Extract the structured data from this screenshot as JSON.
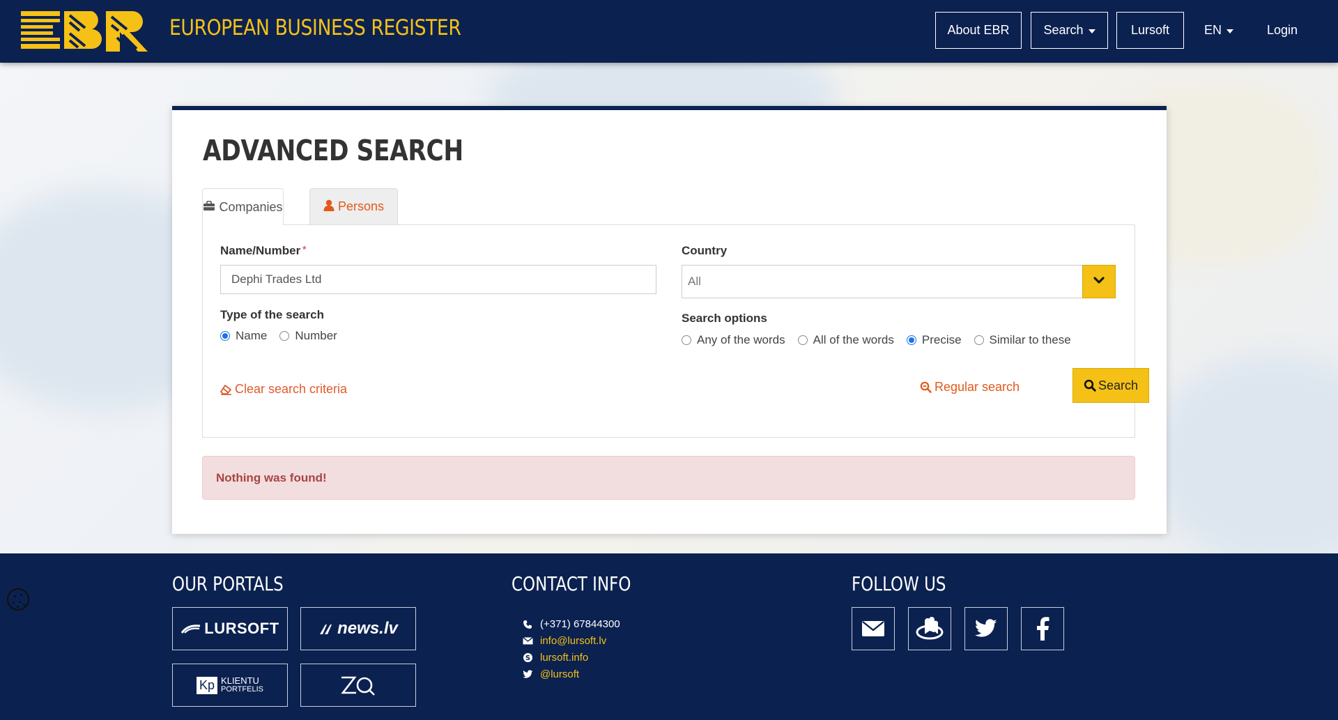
{
  "header": {
    "logo_alt": "EBR",
    "brand_title": "EUROPEAN BUSINESS REGISTER",
    "nav": {
      "about_label": "About EBR",
      "search_label": "Search",
      "lursoft_label": "Lursoft",
      "language_label": "EN",
      "login_label": "Login"
    }
  },
  "panel": {
    "title": "ADVANCED SEARCH",
    "tabs": [
      {
        "label": "Companies",
        "icon": "briefcase-icon",
        "active": true
      },
      {
        "label": "Persons",
        "icon": "user-icon",
        "active": false
      }
    ],
    "form": {
      "name_label": "Name/Number",
      "required_mark": "*",
      "name_value": "Dephi Trades Ltd",
      "type_label": "Type of the search",
      "type_options": [
        "Name",
        "Number"
      ],
      "type_selected": "Name",
      "country_label": "Country",
      "country_value": "All",
      "options_label": "Search options",
      "search_options": [
        "Any of the words",
        "All of the words",
        "Precise",
        "Similar to these"
      ],
      "search_option_selected": "Precise",
      "clear_label": "Clear search criteria",
      "regular_search_label": "Regular search",
      "search_button_label": "Search"
    },
    "alert": "Nothing was found!"
  },
  "footer": {
    "portals_heading": "OUR PORTALS",
    "portals": [
      {
        "name": "LURSOFT",
        "icon": "lursoft-logo"
      },
      {
        "name": "news.lv",
        "icon": "newslv-logo"
      },
      {
        "name_line1": "KLIENTU",
        "name_line2": "PORTFELIS",
        "badge": "Kp"
      },
      {
        "name": "ZQ",
        "icon": "zq-logo"
      }
    ],
    "contact_heading": "CONTACT INFO",
    "contacts": [
      {
        "icon": "phone-icon",
        "text": "(+371) 67844300"
      },
      {
        "icon": "mail-icon",
        "text": "info@lursoft.lv"
      },
      {
        "icon": "skype-icon",
        "text": "lursoft.info"
      },
      {
        "icon": "twitter-icon",
        "text": "@lursoft"
      }
    ],
    "follow_heading": "FOLLOW US",
    "social": [
      "mail-icon",
      "draugiem-icon",
      "twitter-icon",
      "facebook-icon"
    ]
  },
  "colors": {
    "navy": "#0b2150",
    "accent_yellow": "#f5c116",
    "link_orange": "#e2591b",
    "alert_bg": "#f2dede",
    "alert_text": "#a94442"
  }
}
